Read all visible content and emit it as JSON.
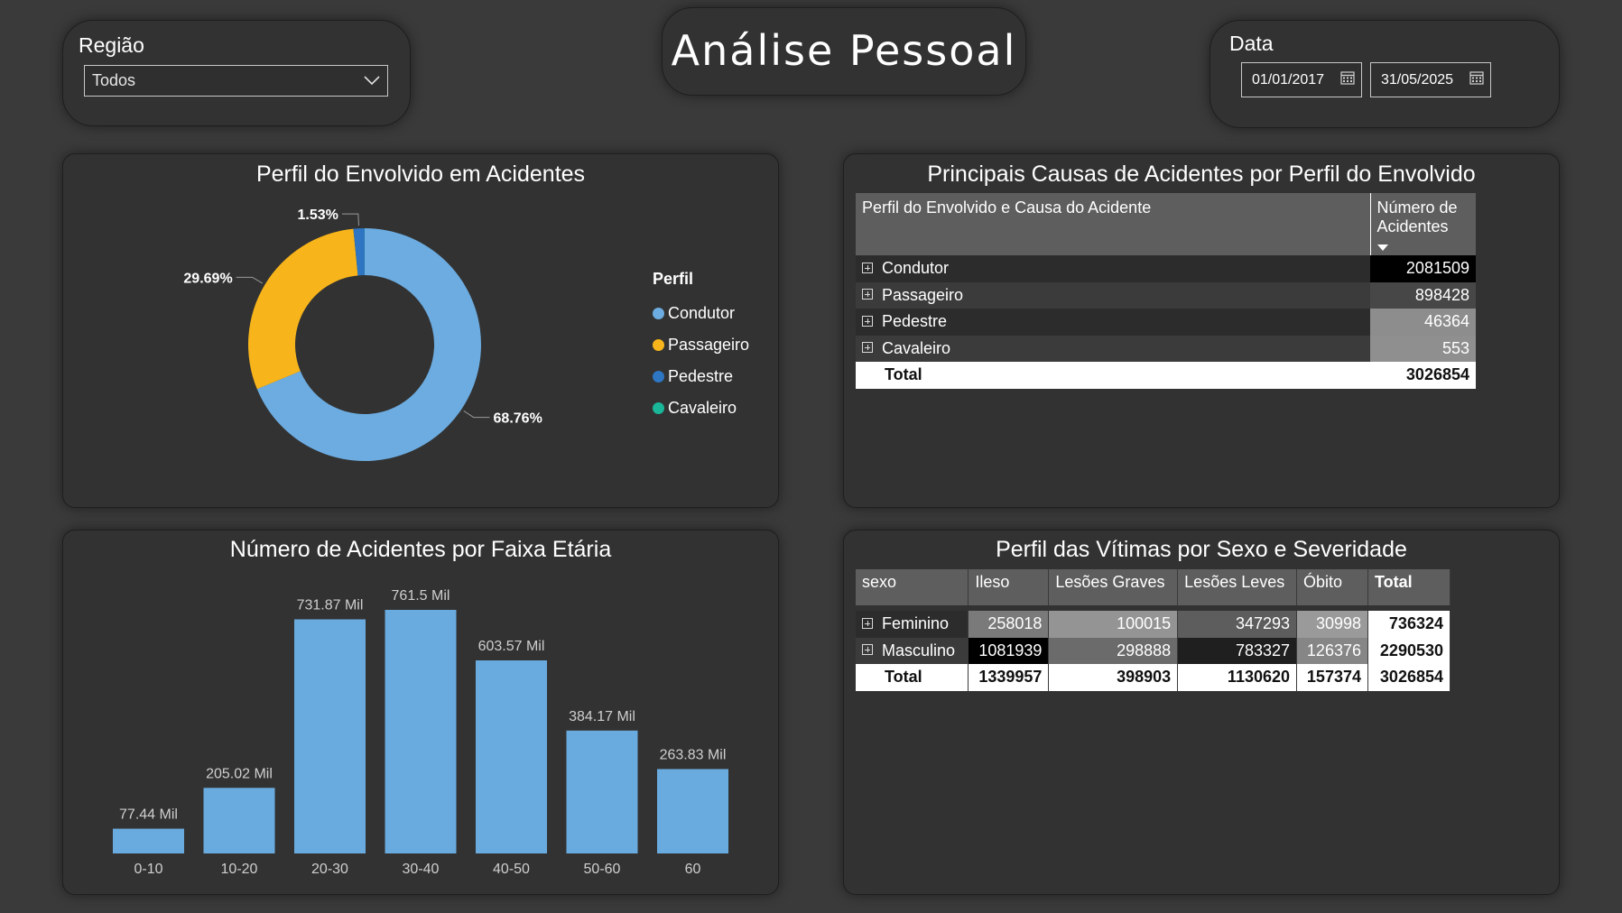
{
  "page_title": "Análise Pessoal",
  "filters": {
    "regiao": {
      "label": "Região",
      "value": "Todos"
    },
    "data": {
      "label": "Data",
      "start": "01/01/2017",
      "end": "31/05/2025"
    }
  },
  "colors": {
    "background": "#3a3a3a",
    "panel": "#323232",
    "condutor": "#6cace1",
    "passageiro": "#f8b51b",
    "pedestre": "#2e75c3",
    "cavaleiro": "#1ab69a",
    "bar": "#6aabdf"
  },
  "perfil_chart": {
    "title": "Perfil do Envolvido em Acidentes",
    "legend_title": "Perfil",
    "legend": [
      "Condutor",
      "Passageiro",
      "Pedestre",
      "Cavaleiro"
    ]
  },
  "causas_table": {
    "title": "Principais Causas de Acidentes por Perfil do Envolvido",
    "col1": "Perfil do Envolvido e Causa do Acidente",
    "col2": "Número de Acidentes",
    "rows": [
      {
        "label": "Condutor",
        "value": "2081509"
      },
      {
        "label": "Passageiro",
        "value": "898428"
      },
      {
        "label": "Pedestre",
        "value": "46364"
      },
      {
        "label": "Cavaleiro",
        "value": "553"
      }
    ],
    "total_label": "Total",
    "total_value": "3026854"
  },
  "faixa_chart": {
    "title": "Número de Acidentes por Faixa Etária"
  },
  "sexo_table": {
    "title": "Perfil das Vítimas por Sexo e Severidade",
    "headers": [
      "sexo",
      "Ileso",
      "Lesões Graves",
      "Lesões Leves",
      "Óbito",
      "Total"
    ],
    "rows": [
      {
        "label": "Feminino",
        "values": [
          "258018",
          "100015",
          "347293",
          "30998",
          "736324"
        ]
      },
      {
        "label": "Masculino",
        "values": [
          "1081939",
          "298888",
          "783327",
          "126376",
          "2290530"
        ]
      }
    ],
    "total": {
      "label": "Total",
      "values": [
        "1339957",
        "398903",
        "1130620",
        "157374",
        "3026854"
      ]
    }
  },
  "chart_data": [
    {
      "type": "pie",
      "title": "Perfil do Envolvido em Acidentes",
      "legend_title": "Perfil",
      "legend_position": "right",
      "categories": [
        "Condutor",
        "Passageiro",
        "Pedestre",
        "Cavaleiro"
      ],
      "values": [
        68.76,
        29.69,
        1.53,
        0.02
      ],
      "labels": [
        "68.76%",
        "29.69%",
        "1.53%",
        ""
      ]
    },
    {
      "type": "bar",
      "title": "Número de Acidentes por Faixa Etária",
      "categories": [
        "0-10",
        "10-20",
        "20-30",
        "30-40",
        "40-50",
        "50-60",
        "60"
      ],
      "values": [
        77440,
        205020,
        731870,
        761500,
        603570,
        384170,
        263830
      ],
      "data_labels": [
        "77.44 Mil",
        "205.02 Mil",
        "731.87 Mil",
        "761.5 Mil",
        "603.57 Mil",
        "384.17 Mil",
        "263.83 Mil"
      ],
      "grid": false
    }
  ]
}
